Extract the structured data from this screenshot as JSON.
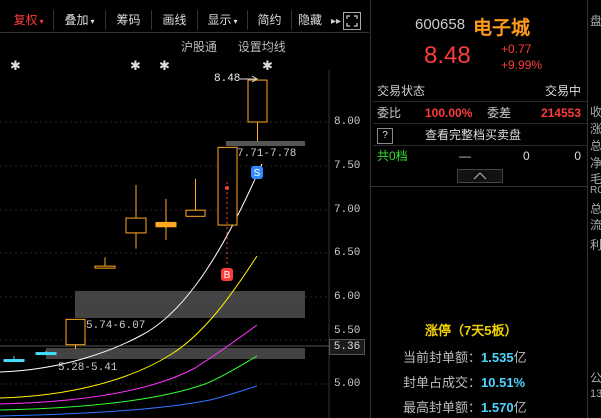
{
  "toolbar": {
    "items": [
      {
        "label": "复权",
        "caret": "▾"
      },
      {
        "label": "叠加",
        "caret": "▾"
      },
      {
        "label": "筹码",
        "caret": ""
      },
      {
        "label": "画线",
        "caret": ""
      },
      {
        "label": "显示",
        "caret": "▾"
      },
      {
        "label": "简约",
        "caret": ""
      },
      {
        "label": "隐藏",
        "caret": ""
      }
    ],
    "more": "▸▸",
    "expand_icon": "fullscreen-icon"
  },
  "sub_links": {
    "hgt": "沪股通",
    "ma_settings": "设置均线"
  },
  "markers": [
    "✱",
    "✱",
    "✱",
    "✱"
  ],
  "chart": {
    "y_labels": [
      "8.00",
      "7.50",
      "7.00",
      "6.50",
      "6.00",
      "5.50",
      "5.00"
    ],
    "high_label": "8.48",
    "zones": [
      "7.71-7.78",
      "5.74-6.07",
      "5.28-5.41"
    ],
    "signal_s": "S",
    "signal_b": "B",
    "current_price": "5.36"
  },
  "chart_data": {
    "type": "candlestick",
    "candles": [
      {
        "open": 5.28,
        "close": 5.28,
        "high": 5.32,
        "low": 5.26
      },
      {
        "open": 5.36,
        "close": 5.36,
        "high": 5.38,
        "low": 5.34
      },
      {
        "open": 5.45,
        "close": 5.74,
        "high": 5.74,
        "low": 5.4
      },
      {
        "open": 6.35,
        "close": 6.35,
        "high": 6.45,
        "low": 6.35
      },
      {
        "open": 6.73,
        "close": 6.9,
        "high": 7.28,
        "low": 6.55
      },
      {
        "open": 6.85,
        "close": 6.8,
        "high": 7.12,
        "low": 6.65
      },
      {
        "open": 6.92,
        "close": 6.99,
        "high": 7.35,
        "low": 6.95
      },
      {
        "open": 6.82,
        "close": 7.71,
        "high": 7.71,
        "low": 6.82
      },
      {
        "open": 8.0,
        "close": 8.48,
        "high": 8.48,
        "low": 7.78
      }
    ],
    "y_ticks": [
      8.0,
      7.5,
      7.0,
      6.5,
      6.0,
      5.5,
      5.0
    ]
  },
  "quote": {
    "code": "600658",
    "name": "电子城",
    "price": "8.48",
    "change": "+0.77",
    "change_pct": "+9.99%"
  },
  "status": {
    "label": "交易状态",
    "value": "交易中"
  },
  "ratio": {
    "label1": "委比",
    "val1": "100.00%",
    "label2": "委差",
    "val2": "214553"
  },
  "full_book": {
    "q": "?",
    "text": "查看完整档买卖盘"
  },
  "level": {
    "label": "共0档",
    "dash": "—",
    "v1": "0",
    "v2": "0"
  },
  "collapse_icon": "chevron-up-icon",
  "limit": {
    "title": "涨停（7天5板）",
    "rows": [
      {
        "label": "当前封单额：",
        "value": "1.535",
        "unit": "亿"
      },
      {
        "label": "封单占成交：",
        "value": "10.51%",
        "unit": ""
      },
      {
        "label": "最高封单额：",
        "value": "1.570",
        "unit": "亿"
      }
    ]
  },
  "edge_text": [
    "盘",
    "收",
    "涨",
    "总",
    "净",
    "毛",
    "RC",
    "总",
    "流",
    "利",
    "公",
    "13"
  ]
}
